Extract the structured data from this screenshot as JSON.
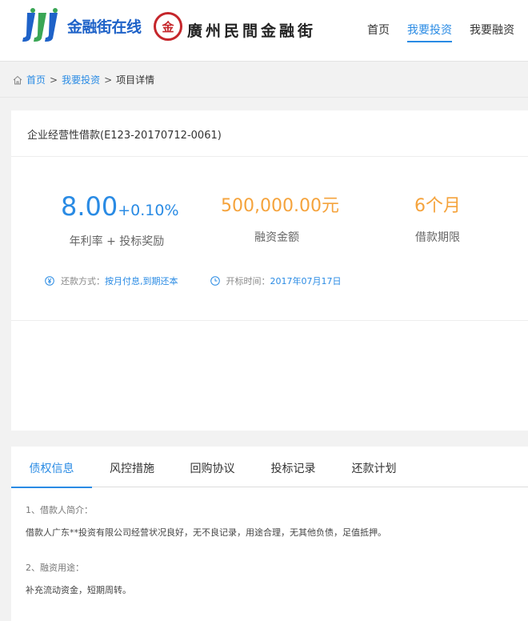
{
  "header": {
    "logo_text": "金融街在线",
    "seal_char": "金",
    "brand2": "廣州民間金融街",
    "nav": [
      {
        "label": "首页",
        "active": false
      },
      {
        "label": "我要投资",
        "active": true
      },
      {
        "label": "我要融资",
        "active": false
      }
    ]
  },
  "breadcrumb": {
    "home": "首页",
    "sep": ">",
    "invest": "我要投资",
    "current": "项目详情"
  },
  "project": {
    "title": "企业经营性借款(E123-20170712-0061)",
    "rate": "8.00",
    "bonus": "+0.10%",
    "rate_label": "年利率 + 投标奖励",
    "amount": "500,000.00元",
    "amount_label": "融资金额",
    "term": "6个月",
    "term_label": "借款期限",
    "repay_label": "还款方式：",
    "repay_value": "按月付息,到期还本",
    "open_label": "开标时间：",
    "open_value": "2017年07月17日"
  },
  "tabs": [
    "债权信息",
    "风控措施",
    "回购协议",
    "投标记录",
    "还款计划"
  ],
  "content": {
    "section1_title": "1、借款人简介：",
    "section1_text": "借款人广东**投资有限公司经营状况良好，无不良记录，用途合理，无其他负债，足值抵押。",
    "section2_title": "2、融资用途：",
    "section2_text": "补充流动资金，短期周转。"
  },
  "colors": {
    "accent": "#2a8be4",
    "orange": "#f5a33c",
    "brand_blue": "#1e62c8",
    "seal_red": "#c5262b"
  }
}
